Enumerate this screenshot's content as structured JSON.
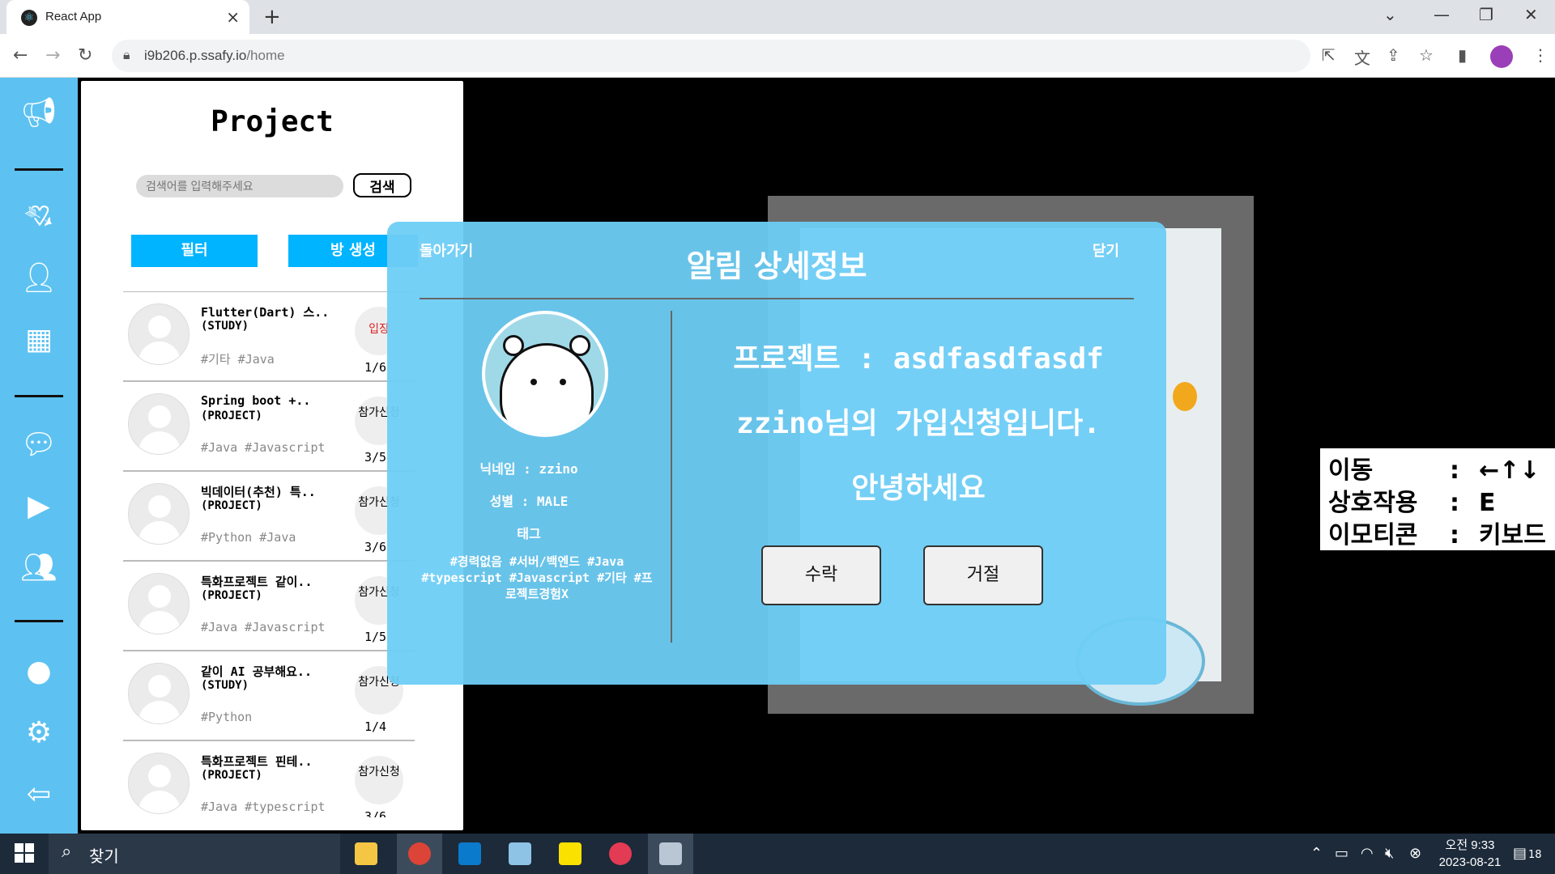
{
  "browser": {
    "tab_title": "React App",
    "url_domain": "i9b206.p.ssafy.io",
    "url_path": "/home"
  },
  "sidebar": {
    "icons": [
      "megaphone-icon",
      "heart-arrow-icon",
      "add-user-icon",
      "dashboard-icon",
      "chat-icon",
      "video-icon",
      "group-icon",
      "user-icon",
      "gear-icon",
      "logout-icon"
    ]
  },
  "project_panel": {
    "title": "Project",
    "search_placeholder": "검색어를 입력해주세요",
    "search_button": "검색",
    "filter_button": "필터",
    "create_room_button": "방 생성",
    "rooms": [
      {
        "name": "Flutter(Dart) 스..",
        "kind": "(STUDY)",
        "tags": "#기타 #Java",
        "action": "입장",
        "count": "1/6"
      },
      {
        "name": "Spring boot +..",
        "kind": "(PROJECT)",
        "tags": "#Java #Javascript",
        "action": "참가신청",
        "count": "3/5"
      },
      {
        "name": "빅데이터(추천) 특..",
        "kind": "(PROJECT)",
        "tags": "#Python #Java",
        "action": "참가신청",
        "count": "3/6"
      },
      {
        "name": "특화프로젝트 같이..",
        "kind": "(PROJECT)",
        "tags": "#Java #Javascript",
        "action": "참가신청",
        "count": "1/5"
      },
      {
        "name": "같이 AI 공부해요..",
        "kind": "(STUDY)",
        "tags": "#Python",
        "action": "참가신청",
        "count": "1/4"
      },
      {
        "name": "특화프로젝트 핀테..",
        "kind": "(PROJECT)",
        "tags": "#Java #typescript",
        "action": "참가신청",
        "count": "3/6"
      }
    ]
  },
  "modal": {
    "back_label": "돌아가기",
    "close_label": "닫기",
    "title": "알림 상세정보",
    "nickname_line": "닉네임 : zzino",
    "gender_line": "성별 : MALE",
    "tag_label": "태그",
    "tags": "#경력없음 #서버/백엔드 #Java #typescript #Javascript #기타 #프로젝트경험X",
    "project_line": "프로젝트 : asdfasdfasdf",
    "request_line": "zzino님의 가입신청입니다.",
    "greeting_line": "안녕하세요",
    "accept_button": "수락",
    "reject_button": "거절"
  },
  "key_help": {
    "rows": [
      {
        "label": "이동",
        "sep": ":",
        "value": "←↑↓"
      },
      {
        "label": "상호작용",
        "sep": ":",
        "value": "E"
      },
      {
        "label": "이모티콘",
        "sep": ":",
        "value": "키보드"
      }
    ]
  },
  "taskbar": {
    "search_text": "찾기",
    "time_period": "오전 9:33",
    "date": "2023-08-21",
    "notification_count": "18"
  },
  "colors": {
    "sidebar": "#5dc2f1",
    "button_blue": "#00b4ff",
    "modal_bg": "#6ecdf5",
    "enter_red": "#e02020"
  }
}
